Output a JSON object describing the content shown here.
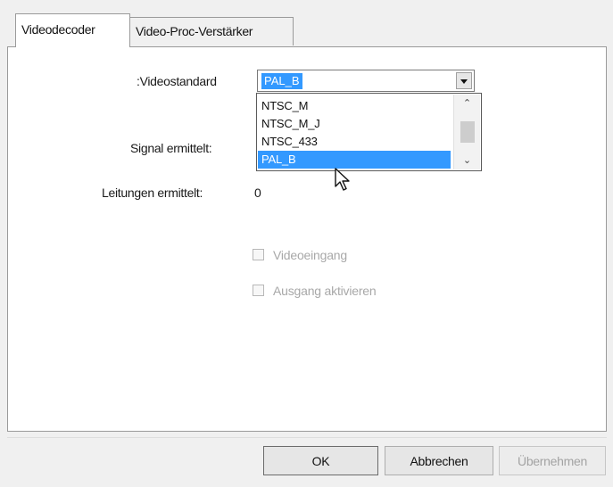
{
  "tabs": [
    {
      "label": "Videodecoder",
      "active": true
    },
    {
      "label": "Video-Proc-Verstärker",
      "active": false
    }
  ],
  "form": {
    "videostandard_label": ":Videostandard",
    "videostandard_value": "PAL_B",
    "signal_label": "Signal ermittelt:",
    "leitungen_label": "Leitungen ermittelt:",
    "leitungen_value": "0"
  },
  "dropdown": {
    "options": [
      "NTSC_M",
      "NTSC_M_J",
      "NTSC_433",
      "PAL_B"
    ],
    "selected": "PAL_B"
  },
  "checkboxes": {
    "videoeingang": {
      "label": "Videoeingang",
      "checked": false,
      "enabled": false
    },
    "ausgang": {
      "label": "Ausgang aktivieren",
      "checked": false,
      "enabled": false
    }
  },
  "buttons": {
    "ok": "OK",
    "cancel": "Abbrechen",
    "apply": "Übernehmen"
  },
  "colors": {
    "selection": "#3399ff",
    "disabled_text": "#a8a8a8",
    "panel_bg": "#ffffff",
    "window_bg": "#f0f0f0"
  }
}
